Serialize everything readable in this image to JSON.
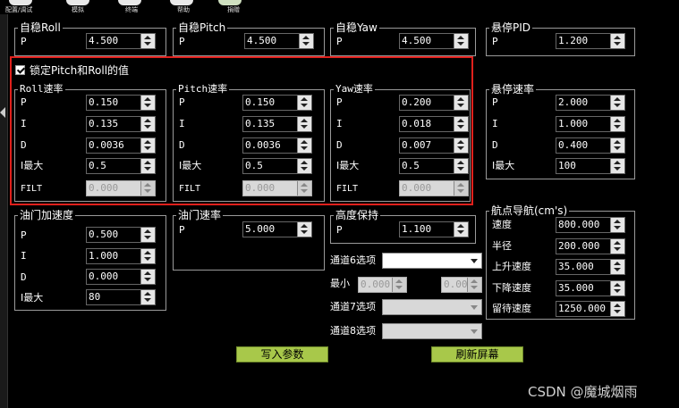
{
  "toolbar": {
    "items": [
      {
        "label": "配置/调试",
        "icon": "config-tune-icon"
      },
      {
        "label": "模拟",
        "icon": "simulation-icon"
      },
      {
        "label": "终端",
        "icon": "terminal-icon"
      },
      {
        "label": "帮助",
        "icon": "help-icon"
      },
      {
        "label": "捐赠",
        "icon": "donate-icon"
      }
    ]
  },
  "lock": {
    "label": "锁定Pitch和Roll的值",
    "checked": true
  },
  "groups": {
    "stab_roll": {
      "title": "自稳Roll",
      "p_label": "P",
      "p": "4.500"
    },
    "stab_pitch": {
      "title": "自稳Pitch",
      "p_label": "P",
      "p": "4.500"
    },
    "stab_yaw": {
      "title": "自稳Yaw",
      "p_label": "P",
      "p": "4.500"
    },
    "loiter_pid": {
      "title": "悬停PID",
      "p_label": "P",
      "p": "1.200"
    },
    "roll_rate": {
      "title": "Roll速率",
      "labels": [
        "P",
        "I",
        "D",
        "I最大",
        "FILT"
      ],
      "values": [
        "0.150",
        "0.135",
        "0.0036",
        "0.5",
        "0.000"
      ]
    },
    "pitch_rate": {
      "title": "Pitch速率",
      "labels": [
        "P",
        "I",
        "D",
        "I最大",
        "FILT"
      ],
      "values": [
        "0.150",
        "0.135",
        "0.0036",
        "0.5",
        "0.000"
      ]
    },
    "yaw_rate": {
      "title": "Yaw速率",
      "labels": [
        "P",
        "I",
        "D",
        "I最大",
        "FILT"
      ],
      "values": [
        "0.200",
        "0.018",
        "0.007",
        "0.5",
        "0.000"
      ]
    },
    "loiter_rate": {
      "title": "悬停速率",
      "labels": [
        "P",
        "I",
        "D",
        "I最大"
      ],
      "values": [
        "2.000",
        "1.000",
        "0.400",
        "100"
      ]
    },
    "throttle_accel": {
      "title": "油门加速度",
      "labels": [
        "P",
        "I",
        "D",
        "I最大"
      ],
      "values": [
        "0.500",
        "1.000",
        "0.000",
        "80"
      ]
    },
    "throttle_rate": {
      "title": "油门速率",
      "p_label": "P",
      "p": "5.000"
    },
    "alt_hold": {
      "title": "高度保持",
      "p_label": "P",
      "p": "1.100"
    },
    "wpnav": {
      "title": "航点导航(cm's)",
      "labels": [
        "速度",
        "半径",
        "上升速度",
        "下降速度",
        "留待速度"
      ],
      "values": [
        "800.000",
        "200.000",
        "35.000",
        "35.000",
        "1250.000"
      ]
    }
  },
  "channels": {
    "ch6_label": "通道6选项",
    "min_label": "最小",
    "min_value": "0.000",
    "max_value": "0.000",
    "ch7_label": "通道7选项",
    "ch8_label": "通道8选项"
  },
  "buttons": {
    "write": "写入参数",
    "refresh": "刷新屏幕"
  },
  "watermark": "CSDN @魔城烟雨",
  "colors": {
    "highlight": "#e0201c",
    "button": "#a8c84a"
  }
}
